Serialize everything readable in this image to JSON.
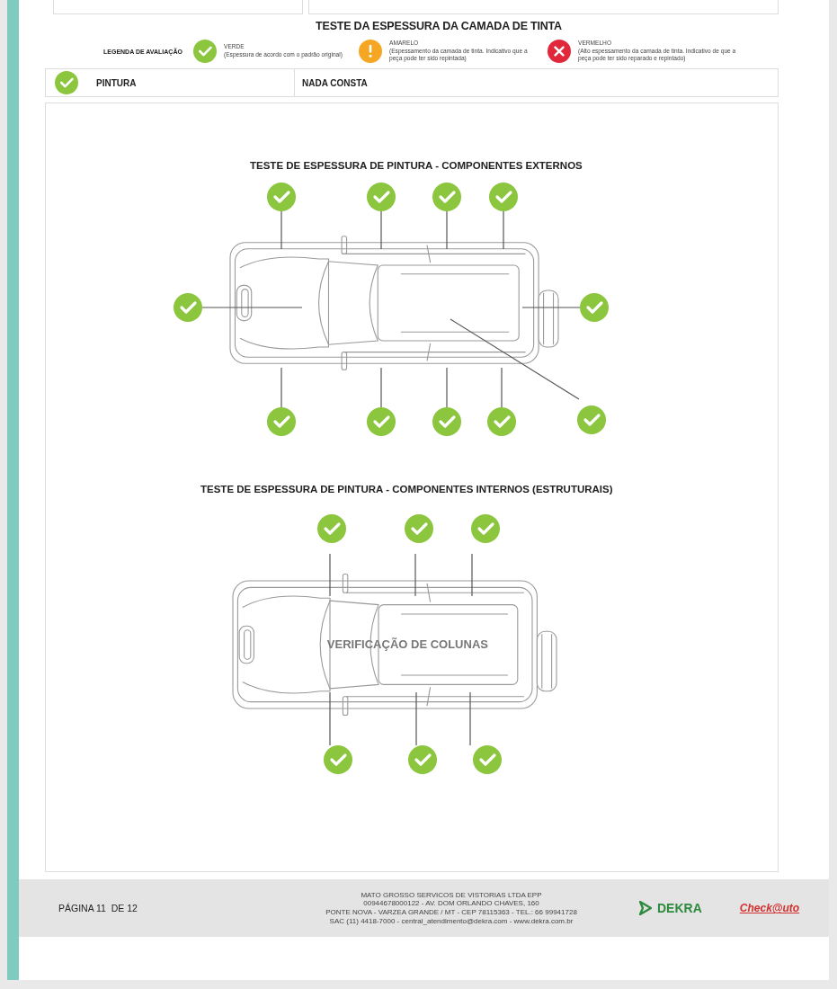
{
  "title": "TESTE DA ESPESSURA DA CAMADA DE TINTA",
  "legend": {
    "label": "LEGENDA DE AVALIAÇÃO",
    "items": [
      {
        "kind": "ok",
        "name": "VERDE",
        "description": "(Espessura de acordo com o padrão original)"
      },
      {
        "kind": "warn",
        "name": "AMARELO",
        "description": "(Espessamento da camada de tinta. Indicativo que a peça pode ter sido repintada)"
      },
      {
        "kind": "bad",
        "name": "VERMELHO",
        "description": "(Alto espessamento da camada de tinta. Indicativo de que a peça pode ter sido reparado e repintado)"
      }
    ]
  },
  "result_row": {
    "kind": "ok",
    "item": "PINTURA",
    "result": "NADA CONSTA"
  },
  "diagrams": [
    {
      "title": "TESTE DE ESPESSURA DE PINTURA - COMPONENTES EXTERNOS",
      "markers": [
        {
          "kind": "ok"
        },
        {
          "kind": "ok"
        },
        {
          "kind": "ok"
        },
        {
          "kind": "ok"
        },
        {
          "kind": "ok"
        },
        {
          "kind": "ok"
        },
        {
          "kind": "ok"
        },
        {
          "kind": "ok"
        },
        {
          "kind": "ok"
        },
        {
          "kind": "ok"
        },
        {
          "kind": "ok"
        }
      ]
    },
    {
      "title": "TESTE DE ESPESSURA DE PINTURA - COMPONENTES INTERNOS (ESTRUTURAIS)",
      "label": "VERIFICAÇÃO DE COLUNAS",
      "markers": [
        {
          "kind": "ok"
        },
        {
          "kind": "ok"
        },
        {
          "kind": "ok"
        },
        {
          "kind": "ok"
        },
        {
          "kind": "ok"
        },
        {
          "kind": "ok"
        }
      ]
    }
  ],
  "footer": {
    "page": "PÁGINA 11  DE 12",
    "company_lines": [
      "MATO GROSSO SERVICOS DE VISTORIAS LTDA EPP",
      "00944678000122 - AV. DOM ORLANDO CHAVES, 160",
      "PONTE NOVA - VARZEA GRANDE / MT - CEP 78115363 - TEL.: 66 99941728",
      "SAC (11) 4418-7000 - central_atendimento@dekra.com - www.dekra.com.br"
    ],
    "logos": [
      "DEKRA",
      "Check@uto"
    ]
  }
}
